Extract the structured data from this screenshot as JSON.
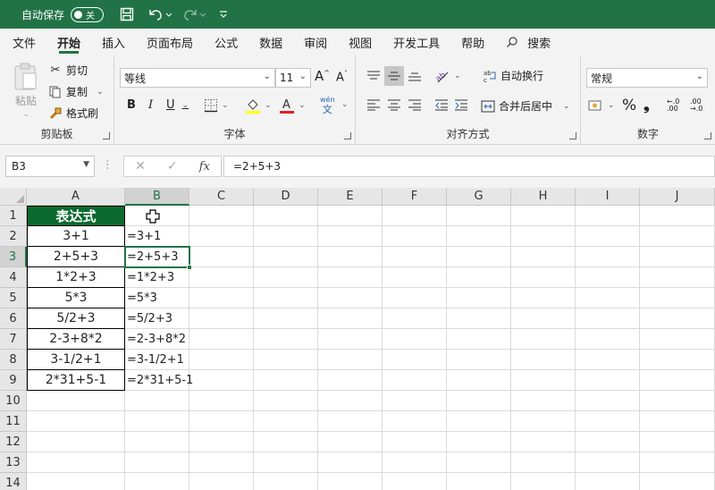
{
  "titlebar": {
    "autosave_label": "自动保存",
    "autosave_state": "关",
    "accent": "#217346"
  },
  "menu": {
    "items": [
      "文件",
      "开始",
      "插入",
      "页面布局",
      "公式",
      "数据",
      "审阅",
      "视图",
      "开发工具",
      "帮助"
    ],
    "active": "开始",
    "search_label": "搜索"
  },
  "ribbon": {
    "clipboard": {
      "paste": "粘贴",
      "cut": "剪切",
      "copy": "复制",
      "format_painter": "格式刷",
      "label": "剪贴板"
    },
    "font": {
      "font_name": "等线",
      "font_size": "11",
      "label": "字体",
      "bold": "B",
      "italic": "I",
      "underline": "U",
      "phonetic_top": "wén",
      "phonetic_bottom": "文"
    },
    "alignment": {
      "wrap_text": "自动换行",
      "merge_center": "合并后居中",
      "label": "对齐方式"
    },
    "number": {
      "format": "常规",
      "label": "数字"
    }
  },
  "formula_bar": {
    "name_box": "B3",
    "fx": "fx",
    "formula": "=2+5+3"
  },
  "sheet": {
    "columns": [
      "A",
      "B",
      "C",
      "D",
      "E",
      "F",
      "G",
      "H",
      "I",
      "J"
    ],
    "selected_column": "B",
    "rows": [
      "1",
      "2",
      "3",
      "4",
      "5",
      "6",
      "7",
      "8",
      "9",
      "10",
      "11",
      "12",
      "13",
      "14"
    ],
    "selected_row": "3",
    "header_A1": "表达式",
    "col_a": [
      "3+1",
      "2+5+3",
      "1*2+3",
      "5*3",
      "5/2+3",
      "2-3+8*2",
      "3-1/2+1",
      "2*31+5-1"
    ],
    "col_b": [
      "=3+1",
      "=2+5+3",
      "=1*2+3",
      "=5*3",
      "=5/2+3",
      "=2-3+8*2",
      "=3-1/2+1",
      "=2*31+5-1"
    ],
    "header_fill": "#0a6a2f"
  }
}
